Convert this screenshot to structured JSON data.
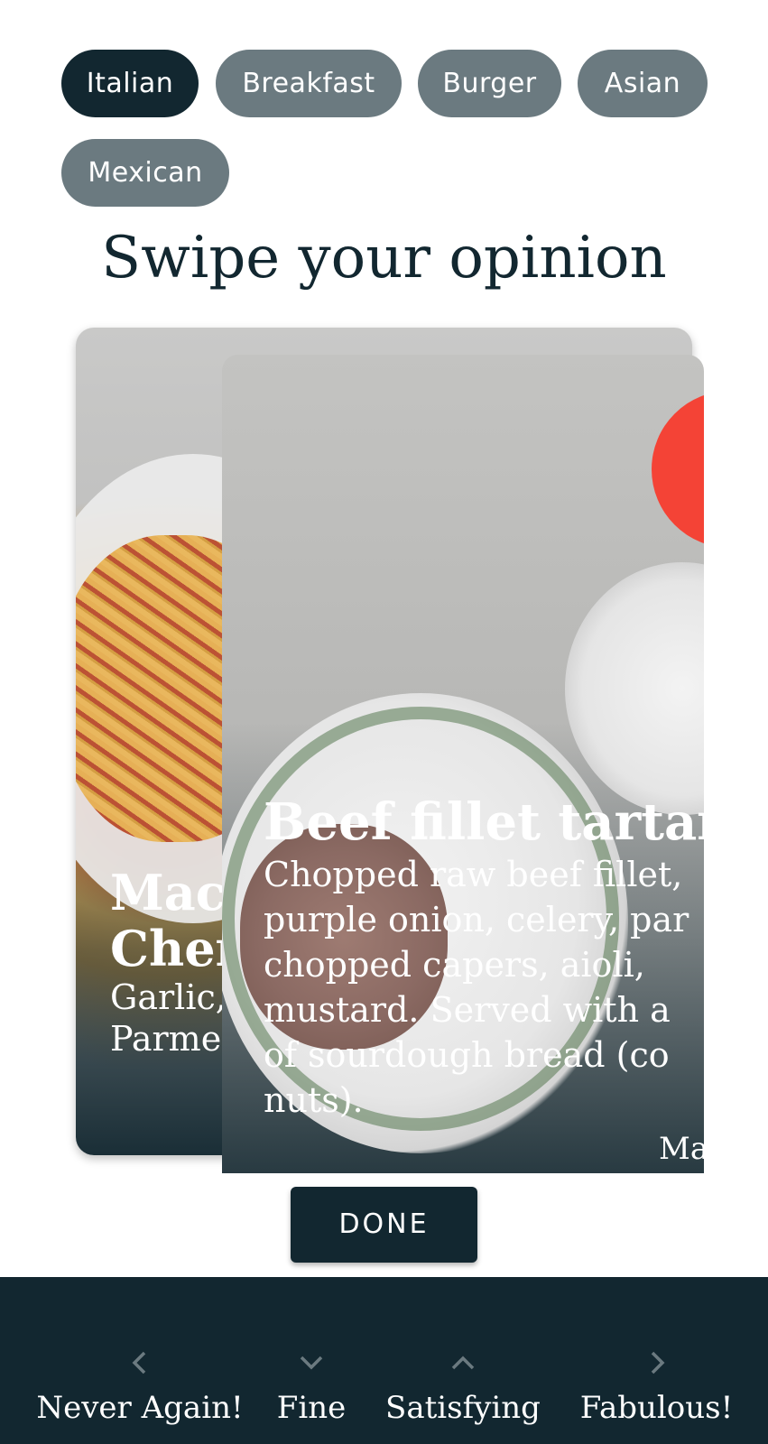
{
  "categories": {
    "items": [
      {
        "label": "Italian",
        "selected": true
      },
      {
        "label": "Breakfast",
        "selected": false
      },
      {
        "label": "Burger",
        "selected": false
      },
      {
        "label": "Asian",
        "selected": false
      },
      {
        "label": "Mexican",
        "selected": false
      }
    ]
  },
  "title": "Swipe your opinion",
  "cards": {
    "back": {
      "title_line1": "Maca",
      "title_line2": "Cher",
      "desc_line1": "Garlic,",
      "desc_line2": "Parmes"
    },
    "front": {
      "title": "Beef fillet tartare",
      "description": "Chopped raw beef fillet,\npurple onion, celery, par\nchopped capers, aioli,\nmustard. Served with a\nof sourdough bread (co\nnuts).",
      "tag": "Ma"
    }
  },
  "done_label": "DONE",
  "ratings": [
    {
      "label": "Never Again!",
      "icon": "chevron-left-icon"
    },
    {
      "label": "Fine",
      "icon": "chevron-down-icon"
    },
    {
      "label": "Satisfying",
      "icon": "chevron-up-icon"
    },
    {
      "label": "Fabulous!",
      "icon": "chevron-right-icon"
    }
  ],
  "colors": {
    "primary_dark": "#122730",
    "chip_inactive": "#6b7a80",
    "accent_red": "#f44336"
  }
}
